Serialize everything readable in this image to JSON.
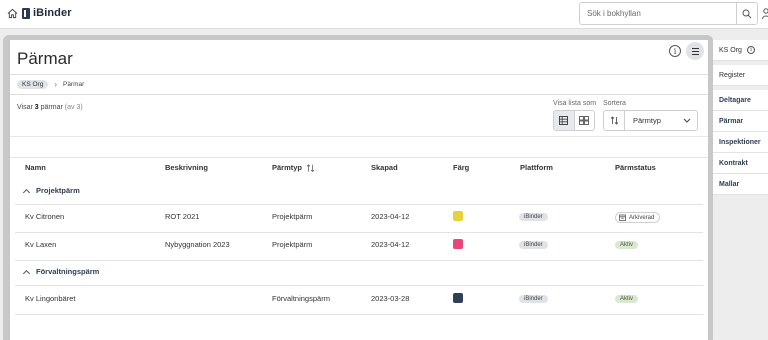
{
  "app": {
    "name": "iBinder",
    "search_placeholder": "Sök i bokhyllan"
  },
  "page": {
    "title": "Pärmar",
    "breadcrumb": [
      "KS Org",
      "Pärmar"
    ],
    "summary_prefix": "Visar",
    "summary_count": "3",
    "summary_noun": "pärmar",
    "summary_total": "(av 3)"
  },
  "controls": {
    "view_label": "Visa lista som",
    "sort_label": "Sortera",
    "sort_value": "Pärmtyp"
  },
  "table": {
    "columns": [
      "Namn",
      "Beskrivning",
      "Pärmtyp",
      "Skapad",
      "Färg",
      "Plattform",
      "Pärmstatus"
    ],
    "groups": [
      {
        "label": "Projektpärm",
        "rows": [
          {
            "name": "Kv Citronen",
            "description": "ROT 2021",
            "type": "Projektpärm",
            "created": "2023-04-12",
            "color": "#e2d43a",
            "platform": "iBinder",
            "status": "Arkiverad"
          },
          {
            "name": "Kv Laxen",
            "description": "Nybyggnation 2023",
            "type": "Projektpärm",
            "created": "2023-04-12",
            "color": "#e8457d",
            "platform": "iBinder",
            "status": "Aktiv"
          }
        ]
      },
      {
        "label": "Förvaltningspärm",
        "rows": [
          {
            "name": "Kv Lingonbäret",
            "description": "",
            "type": "Förvaltningspärm",
            "created": "2023-03-28",
            "color": "#2f4058",
            "platform": "iBinder",
            "status": "Aktiv"
          }
        ]
      }
    ]
  },
  "sidebar": {
    "org": "KS Org",
    "items": [
      "Register",
      "Deltagare",
      "Pärmar",
      "Inspektioner",
      "Kontrakt",
      "Mallar"
    ]
  }
}
